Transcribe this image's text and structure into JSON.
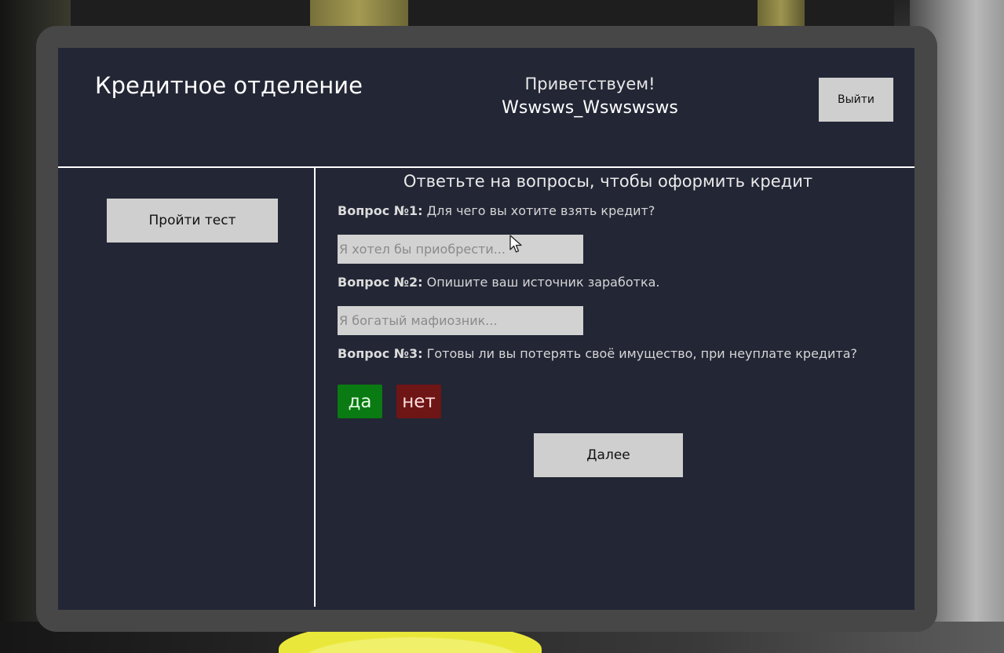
{
  "header": {
    "title": "Кредитное отделение",
    "greeting": "Приветствуем!",
    "username": "Wswsws_Wswswsws",
    "logout_label": "Выйти"
  },
  "sidebar": {
    "test_button_label": "Пройти тест"
  },
  "main": {
    "title": "Ответьте на вопросы, чтобы оформить кредит",
    "questions": [
      {
        "prefix": "Вопрос №1:",
        "text": "Для чего вы хотите взять кредит?",
        "placeholder": "Я хотел бы приобрести..."
      },
      {
        "prefix": "Вопрос №2:",
        "text": "Опишите ваш источник заработка.",
        "placeholder": "Я богатый мафиозник..."
      },
      {
        "prefix": "Вопрос №3:",
        "text": "Готовы ли вы потерять своё имущество, при неуплате кредита?"
      }
    ],
    "yes_label": "да",
    "no_label": "нет",
    "next_label": "Далее"
  },
  "colors": {
    "panel": "#232635",
    "yes": "#0a7a12",
    "no": "#6e1515",
    "button": "#cfcfcf"
  }
}
